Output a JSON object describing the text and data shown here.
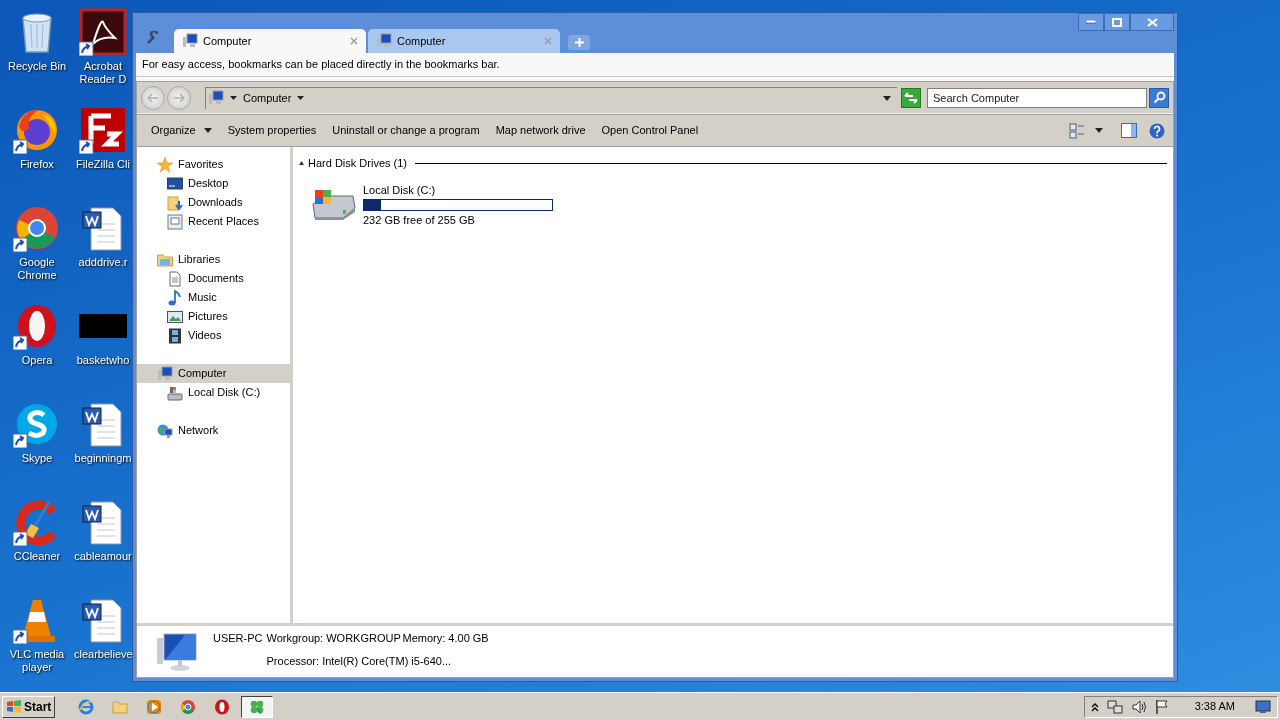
{
  "desktop_icons": [
    {
      "label": "Recycle Bin",
      "kind": "recycle",
      "shortcut": false
    },
    {
      "label": "Acrobat Reader D",
      "kind": "acrobat",
      "shortcut": true
    },
    {
      "label": "Firefox",
      "kind": "firefox",
      "shortcut": true
    },
    {
      "label": "FileZilla Cli",
      "kind": "filezilla",
      "shortcut": true
    },
    {
      "label": "Google Chrome",
      "kind": "chrome",
      "shortcut": true
    },
    {
      "label": "adddrive.r",
      "kind": "doc",
      "shortcut": false
    },
    {
      "label": "Opera",
      "kind": "opera",
      "shortcut": true
    },
    {
      "label": "basketwho",
      "kind": "thumb",
      "shortcut": false
    },
    {
      "label": "Skype",
      "kind": "skype",
      "shortcut": true
    },
    {
      "label": "beginningm",
      "kind": "doc",
      "shortcut": false
    },
    {
      "label": "CCleaner",
      "kind": "ccleaner",
      "shortcut": true
    },
    {
      "label": "cableamour",
      "kind": "doc",
      "shortcut": false
    },
    {
      "label": "VLC media player",
      "kind": "vlc",
      "shortcut": true
    },
    {
      "label": "clearbelieve",
      "kind": "doc",
      "shortcut": false
    }
  ],
  "window": {
    "tabs": [
      {
        "label": "Computer",
        "selected": true
      },
      {
        "label": "Computer",
        "selected": false
      }
    ],
    "bookmarks_hint": "For easy access, bookmarks can be placed directly in the bookmarks bar.",
    "address": {
      "crumb": "Computer"
    },
    "search": {
      "placeholder": "Search Computer"
    },
    "toolbar": [
      {
        "label": "Organize",
        "dropdown": true
      },
      {
        "label": "System properties",
        "dropdown": false
      },
      {
        "label": "Uninstall or change a program",
        "dropdown": false
      },
      {
        "label": "Map network drive",
        "dropdown": false
      },
      {
        "label": "Open Control Panel",
        "dropdown": false
      }
    ],
    "sidebar": [
      {
        "label": "Favorites",
        "kind": "star",
        "selected": false,
        "children": [
          {
            "label": "Desktop",
            "kind": "desktop",
            "selected": false
          },
          {
            "label": "Downloads",
            "kind": "downloads",
            "selected": false
          },
          {
            "label": "Recent Places",
            "kind": "recent",
            "selected": false
          }
        ]
      },
      {
        "label": "Libraries",
        "kind": "libraries",
        "selected": false,
        "children": [
          {
            "label": "Documents",
            "kind": "documents",
            "selected": false
          },
          {
            "label": "Music",
            "kind": "music",
            "selected": false
          },
          {
            "label": "Pictures",
            "kind": "pictures",
            "selected": false
          },
          {
            "label": "Videos",
            "kind": "videos",
            "selected": false
          }
        ]
      },
      {
        "label": "Computer",
        "kind": "computer",
        "selected": true,
        "children": [
          {
            "label": "Local Disk (C:)",
            "kind": "drive",
            "selected": false
          }
        ]
      },
      {
        "label": "Network",
        "kind": "network",
        "selected": false
      }
    ],
    "group": {
      "title": "Hard Disk Drives (1)",
      "expanded": true
    },
    "drives": [
      {
        "name": "Local Disk (C:)",
        "level": 0.09,
        "free": "232 GB free of 255 GB"
      }
    ],
    "details": {
      "name": "USER-PC",
      "workgroup": "Workgroup: WORKGROUP",
      "memory": "Memory: 4.00 GB",
      "processor": "Processor: Intel(R) Core(TM) i5-640..."
    }
  },
  "taskbar": {
    "start": "Start",
    "apps": [
      {
        "kind": "ie",
        "selected": false
      },
      {
        "kind": "folder",
        "selected": false
      },
      {
        "kind": "media",
        "selected": false
      },
      {
        "kind": "chrome",
        "selected": false
      },
      {
        "kind": "opera",
        "selected": false
      },
      {
        "kind": "clover",
        "selected": true
      }
    ],
    "clock": "3:38 AM"
  }
}
